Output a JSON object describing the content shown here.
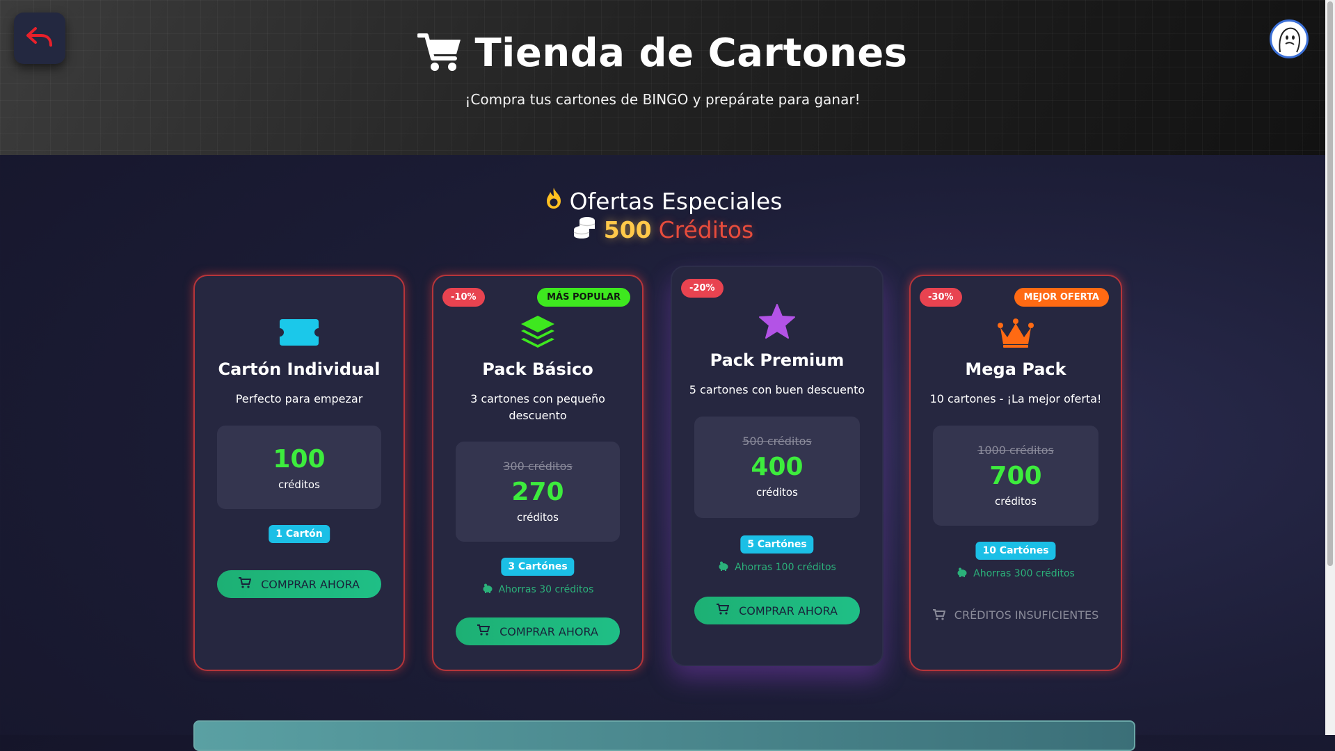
{
  "header": {
    "title": "Tienda de Cartones",
    "subtitle": "¡Compra tus cartones de BINGO y prepárate para ganar!"
  },
  "offers": {
    "title": "Ofertas Especiales",
    "credits_amount": "500",
    "credits_label": "Créditos"
  },
  "colors": {
    "accent_green": "#3dec3d",
    "button_green": "#1db074",
    "discount_red": "#e84350",
    "quantity_cyan": "#1bbfe6"
  },
  "cards": [
    {
      "icon": "ticket-icon",
      "name": "Cartón Individual",
      "description": "Perfecto para empezar",
      "price": "100",
      "price_unit": "créditos",
      "quantity": "1 Cartón",
      "button": "COMPRAR AHORA"
    },
    {
      "icon": "layers-icon",
      "discount": "-10%",
      "tag": "MÁS POPULAR",
      "name": "Pack Básico",
      "description": "3 cartones con pequeño descuento",
      "old_price": "300 créditos",
      "price": "270",
      "price_unit": "créditos",
      "quantity": "3 Cartónes",
      "savings": "Ahorras 30 créditos",
      "button": "COMPRAR AHORA"
    },
    {
      "icon": "star-icon",
      "discount": "-20%",
      "name": "Pack Premium",
      "description": "5 cartones con buen descuento",
      "old_price": "500 créditos",
      "price": "400",
      "price_unit": "créditos",
      "quantity": "5 Cartónes",
      "savings": "Ahorras 100 créditos",
      "button": "COMPRAR AHORA"
    },
    {
      "icon": "crown-icon",
      "discount": "-30%",
      "tag": "MEJOR OFERTA",
      "name": "Mega Pack",
      "description": "10 cartones - ¡La mejor oferta!",
      "old_price": "1000 créditos",
      "price": "700",
      "price_unit": "créditos",
      "quantity": "10 Cartónes",
      "savings": "Ahorras 300 créditos",
      "button": "CRÉDITOS INSUFICIENTES"
    }
  ]
}
